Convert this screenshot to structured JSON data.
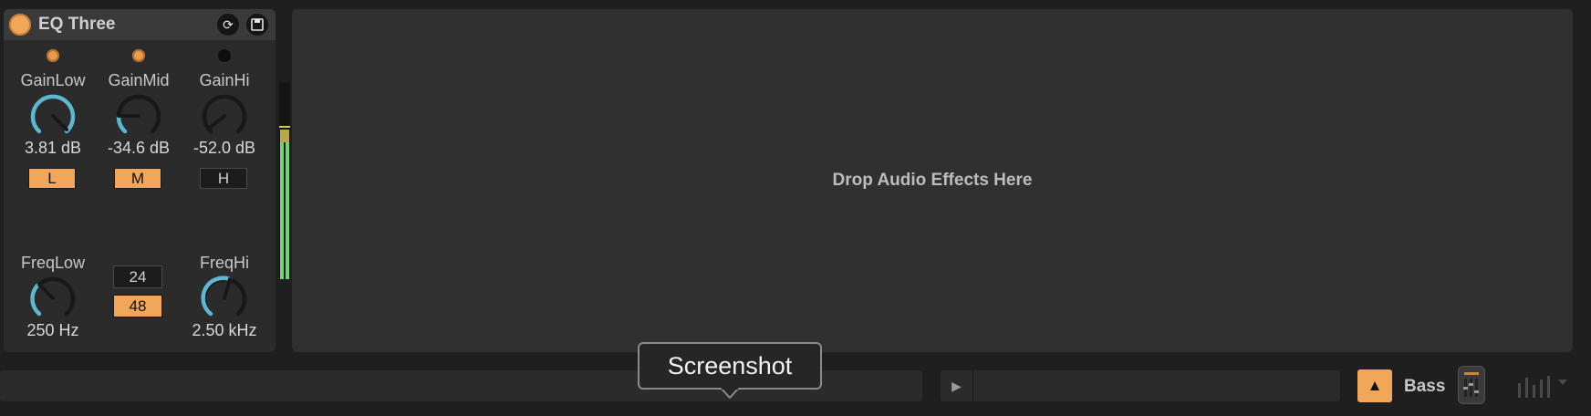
{
  "device": {
    "title": "EQ Three",
    "gain_low": {
      "label": "GainLow",
      "value": "3.81 dB",
      "band_toggle": "L",
      "led_on": true,
      "band_on": true
    },
    "gain_mid": {
      "label": "GainMid",
      "value": "-34.6 dB",
      "band_toggle": "M",
      "led_on": true,
      "band_on": true
    },
    "gain_hi": {
      "label": "GainHi",
      "value": "-52.0 dB",
      "band_toggle": "H",
      "led_on": false,
      "band_on": false
    },
    "freq_low": {
      "label": "FreqLow",
      "value": "250 Hz"
    },
    "freq_hi": {
      "label": "FreqHi",
      "value": "2.50 kHz"
    },
    "slope": {
      "option_24": "24",
      "option_48": "48",
      "selected": "48"
    },
    "header_icons": [
      "refresh-icon",
      "save-icon"
    ]
  },
  "dropzone": {
    "text": "Drop Audio Effects Here"
  },
  "bottom": {
    "track_name": "Bass",
    "icons": [
      "play-icon",
      "warning-triangle-icon",
      "mixer-icon",
      "bars-icon",
      "chevron-down-icon"
    ]
  },
  "tooltip": {
    "text": "Screenshot"
  },
  "colors": {
    "accent": "#f2a65a",
    "knob_arc": "#5bb8d0",
    "meter_green": "#6fd66f",
    "meter_yellow": "#c8b84a"
  }
}
